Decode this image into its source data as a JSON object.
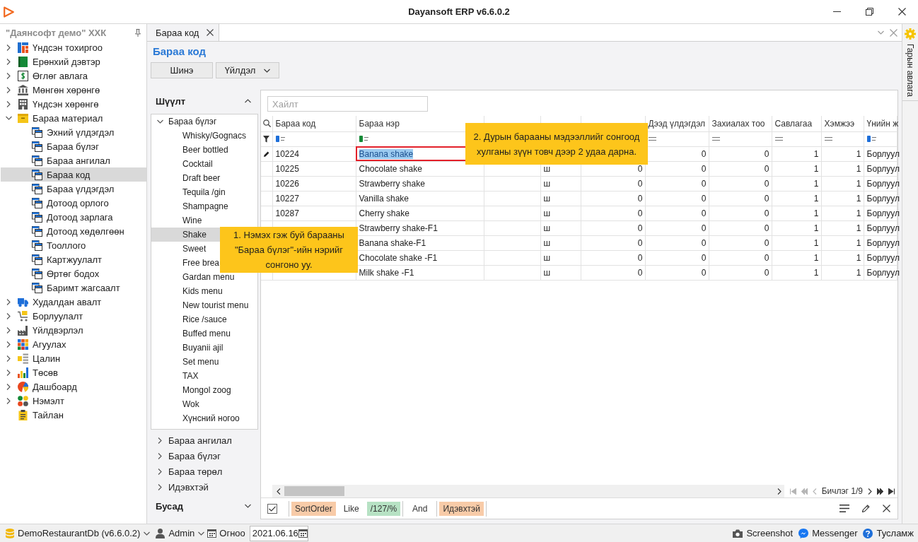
{
  "window": {
    "title": "Dayansoft ERP v6.6.0.2"
  },
  "sidebar": {
    "title": "\"Даянсофт демо\" ХХК",
    "items": [
      {
        "label": "Үндсэн тохиргоо",
        "kind": "group",
        "expanded": false,
        "selected": false
      },
      {
        "label": "Ерөнхий дэвтэр",
        "kind": "group",
        "expanded": false,
        "selected": false
      },
      {
        "label": "Өглөг авлага",
        "kind": "group",
        "expanded": false,
        "selected": false
      },
      {
        "label": "Мөнгөн хөрөнгө",
        "kind": "group",
        "expanded": false,
        "selected": false
      },
      {
        "label": "Үндсэн хөрөнгө",
        "kind": "group",
        "expanded": false,
        "selected": false
      },
      {
        "label": "Бараа материал",
        "kind": "group",
        "expanded": true,
        "selected": false,
        "children": [
          {
            "label": "Эхний үлдэгдэл",
            "selected": false
          },
          {
            "label": "Бараа бүлэг",
            "selected": false
          },
          {
            "label": "Бараа ангилал",
            "selected": false
          },
          {
            "label": "Бараа код",
            "selected": true
          },
          {
            "label": "Бараа үлдэгдэл",
            "selected": false
          },
          {
            "label": "Дотоод орлого",
            "selected": false
          },
          {
            "label": "Дотоод зарлага",
            "selected": false
          },
          {
            "label": "Дотоод хөдөлгөөн",
            "selected": false
          },
          {
            "label": "Тооллого",
            "selected": false
          },
          {
            "label": "Картжуулалт",
            "selected": false
          },
          {
            "label": "Өртөг бодох",
            "selected": false
          },
          {
            "label": "Баримт жагсаалт",
            "selected": false
          }
        ]
      },
      {
        "label": "Худалдан авалт",
        "kind": "group",
        "expanded": false,
        "selected": false
      },
      {
        "label": "Борлуулалт",
        "kind": "group",
        "expanded": false,
        "selected": false
      },
      {
        "label": "Үйлдвэрлэл",
        "kind": "group",
        "expanded": false,
        "selected": false
      },
      {
        "label": "Агуулах",
        "kind": "group",
        "expanded": false,
        "selected": false
      },
      {
        "label": "Цалин",
        "kind": "group",
        "expanded": false,
        "selected": false
      },
      {
        "label": "Төсөв",
        "kind": "group",
        "expanded": false,
        "selected": false
      },
      {
        "label": "Дашбоард",
        "kind": "group",
        "expanded": false,
        "selected": false
      },
      {
        "label": "Нэмэлт",
        "kind": "group",
        "expanded": false,
        "selected": false
      },
      {
        "label": "Тайлан",
        "kind": "leaf",
        "selected": false
      }
    ]
  },
  "tabs": [
    {
      "label": "Бараа код",
      "selected": true
    }
  ],
  "page": {
    "title": "Бараа код",
    "toolbar": [
      {
        "label": "Шинэ",
        "kind": "button"
      },
      {
        "label": "Үйлдэл",
        "kind": "dropdown"
      }
    ]
  },
  "filter_panel": {
    "title": "Шүүлт",
    "expanded": true,
    "tree": [
      {
        "label": "Бараа бүлэг",
        "expanded": true,
        "selected": false,
        "children": [
          {
            "label": "Whisky/Gognacs",
            "selected": false
          },
          {
            "label": "Beer bottled",
            "selected": false
          },
          {
            "label": "Cocktail",
            "selected": false
          },
          {
            "label": "Draft beer",
            "selected": false
          },
          {
            "label": "Tequila /gin",
            "selected": false
          },
          {
            "label": "Shampagne",
            "selected": false
          },
          {
            "label": "Wine",
            "selected": false
          },
          {
            "label": "Shake",
            "selected": true
          },
          {
            "label": "Sweet",
            "selected": false
          },
          {
            "label": "Free brea",
            "selected": false
          },
          {
            "label": "Gardan menu",
            "selected": false
          },
          {
            "label": "Kids menu",
            "selected": false
          },
          {
            "label": "New tourist menu",
            "selected": false
          },
          {
            "label": "Rice /sauce",
            "selected": false
          },
          {
            "label": "Buffed menu",
            "selected": false
          },
          {
            "label": "Buyanii ajil",
            "selected": false
          },
          {
            "label": "Set menu",
            "selected": false
          },
          {
            "label": "TAX",
            "selected": false
          },
          {
            "label": "Mongol zoog",
            "selected": false
          },
          {
            "label": "Wok",
            "selected": false
          },
          {
            "label": "Хүнсний ногоо",
            "selected": false
          }
        ]
      }
    ],
    "groups": [
      {
        "label": "Бараа ангилал",
        "expanded": false
      },
      {
        "label": "Бараа бүлэг",
        "expanded": false
      },
      {
        "label": "Бараа төрөл",
        "expanded": false
      },
      {
        "label": "Идэвхтэй",
        "expanded": false
      }
    ],
    "other_section": {
      "title": "Бусад",
      "expanded": false
    }
  },
  "table": {
    "search": {
      "placeholder": "Хайлт"
    },
    "columns": [
      {
        "label": "Бараа код",
        "kind": "text",
        "filter": {
          "kind": "begins"
        }
      },
      {
        "label": "Бараа нэр",
        "kind": "text",
        "filter": {
          "kind": "contains"
        }
      },
      {},
      {
        "kind": "text"
      },
      {
        "kind": "number"
      },
      {
        "label": "Дээд үлдэгдэл",
        "kind": "number",
        "filter": {
          "kind": "equals"
        }
      },
      {
        "label": "Захиалах тоо",
        "kind": "number",
        "filter": {
          "kind": "equals"
        }
      },
      {
        "label": "Савлагаа",
        "kind": "number",
        "filter": {
          "kind": "equals"
        }
      },
      {
        "label": "Хэмжээ",
        "kind": "number",
        "filter": {
          "kind": "equals"
        }
      },
      {
        "label": "Үнийн ж",
        "kind": "text",
        "filter": {
          "kind": "begins"
        }
      }
    ],
    "rows": [
      {
        "selected": true,
        "cells": [
          "10224",
          "Banana shake",
          null,
          null,
          null,
          "0",
          "0",
          "1",
          "1",
          "Борлуул"
        ]
      },
      {
        "selected": false,
        "cells": [
          "10225",
          "Chocolate shake",
          null,
          "ш",
          "0",
          "0",
          "0",
          "1",
          "1",
          "Борлуул"
        ]
      },
      {
        "selected": false,
        "cells": [
          "10226",
          "Strawberry shake",
          null,
          "ш",
          "0",
          "0",
          "0",
          "1",
          "1",
          "Борлуул"
        ]
      },
      {
        "selected": false,
        "cells": [
          "10227",
          "Vanilla shake",
          null,
          "ш",
          "0",
          "0",
          "0",
          "1",
          "1",
          "Борлуул"
        ]
      },
      {
        "selected": false,
        "cells": [
          "10287",
          "Cherry shake",
          null,
          "ш",
          "0",
          "0",
          "0",
          "1",
          "1",
          "Борлуул"
        ]
      },
      {
        "selected": false,
        "cells": [
          null,
          "Strawberry shake-F1",
          null,
          "ш",
          "0",
          "0",
          "0",
          "1",
          "1",
          "Борлуул"
        ]
      },
      {
        "selected": false,
        "cells": [
          null,
          "Banana shake-F1",
          null,
          "ш",
          "0",
          "0",
          "0",
          "1",
          "1",
          "Борлуул"
        ]
      },
      {
        "selected": false,
        "cells": [
          null,
          "Chocolate shake -F1",
          null,
          "ш",
          "0",
          "0",
          "0",
          "1",
          "1",
          "Борлуул"
        ]
      },
      {
        "selected": false,
        "cells": [
          null,
          "Milk shake -F1",
          null,
          "ш",
          "0",
          "0",
          "0",
          "1",
          "1",
          "Борлуул"
        ]
      }
    ],
    "pager": {
      "label": "Бичлэг 1/9",
      "previous_disabled": true,
      "next_disabled": false
    },
    "filter_bar": {
      "enabled": true,
      "expression": [
        {
          "kind": "group",
          "parts": [
            {
              "kind": "field",
              "text": "SortOrder"
            },
            {
              "kind": "operator",
              "text": "Like"
            },
            {
              "kind": "value",
              "text": "/127/%"
            }
          ]
        },
        {
          "kind": "operator",
          "text": "And"
        },
        {
          "kind": "group",
          "parts": [
            {
              "kind": "field",
              "text": "Идэвхтэй"
            }
          ]
        }
      ]
    }
  },
  "help_panel": {
    "label": "Гарын авлага"
  },
  "callouts": [
    "1. Нэмэх гэж буй барааны \"Бараа бүлэг\"-ийн нэрийг сонгоно уу.",
    "2. Дурын барааны мэдээллийг сонгоод хулганы зүүн товч дээр 2 удаа дарна."
  ],
  "status_bar": {
    "database": "DemoRestaurantDb (v6.6.0.2)",
    "user": "Admin",
    "date_label": "Огноо",
    "date": "2021.06.16",
    "links": [
      "Screenshot",
      "Messenger",
      "Тусламж"
    ]
  }
}
